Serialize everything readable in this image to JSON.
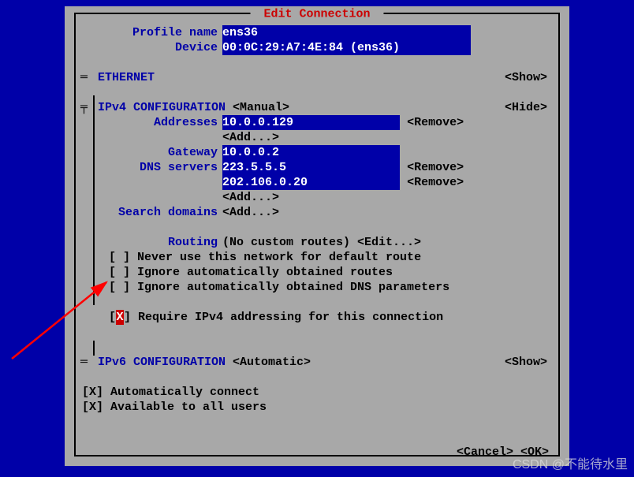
{
  "dialog": {
    "title": " Edit Connection "
  },
  "header": {
    "profile_label": "Profile name",
    "profile_value": "ens36                              ",
    "device_label": "Device",
    "device_value": "00:0C:29:A7:4E:84 (ens36)          "
  },
  "ethernet": {
    "marker": "═ ",
    "title": "ETHERNET",
    "show": "<Show>"
  },
  "ipv4": {
    "marker": "╤ ",
    "title": "IPv4 CONFIGURATION",
    "mode": "<Manual>",
    "hide": "<Hide>",
    "addresses_label": "Addresses",
    "addresses_value": "10.0.0.129               ",
    "addresses_remove": "<Remove>",
    "addresses_add": "<Add...>",
    "gateway_label": "Gateway",
    "gateway_value": "10.0.0.2                 ",
    "dns_label": "DNS servers",
    "dns1_value": "223.5.5.5                ",
    "dns1_remove": "<Remove>",
    "dns2_value": "202.106.0.20             ",
    "dns2_remove": "<Remove>",
    "dns_add": "<Add...>",
    "search_label": "Search domains",
    "search_add": "<Add...>",
    "routing_label": "Routing",
    "routing_value": "(No custom routes)",
    "routing_edit": "<Edit...>",
    "cb1": "[ ] Never use this network for default route",
    "cb2": "[ ] Ignore automatically obtained routes",
    "cb3": "[ ] Ignore automatically obtained DNS parameters",
    "require_pre": "[",
    "require_x": "X",
    "require_post": "] Require IPv4 addressing for this connection"
  },
  "ipv6": {
    "marker": "═ ",
    "title": "IPv6 CONFIGURATION",
    "mode": "<Automatic>",
    "show": "<Show>"
  },
  "bottom": {
    "auto": "[X] Automatically connect",
    "avail": "[X] Available to all users"
  },
  "footer": {
    "cancel": "<Cancel>",
    "ok": "<OK>"
  },
  "watermark": "CSDN @不能待水里"
}
